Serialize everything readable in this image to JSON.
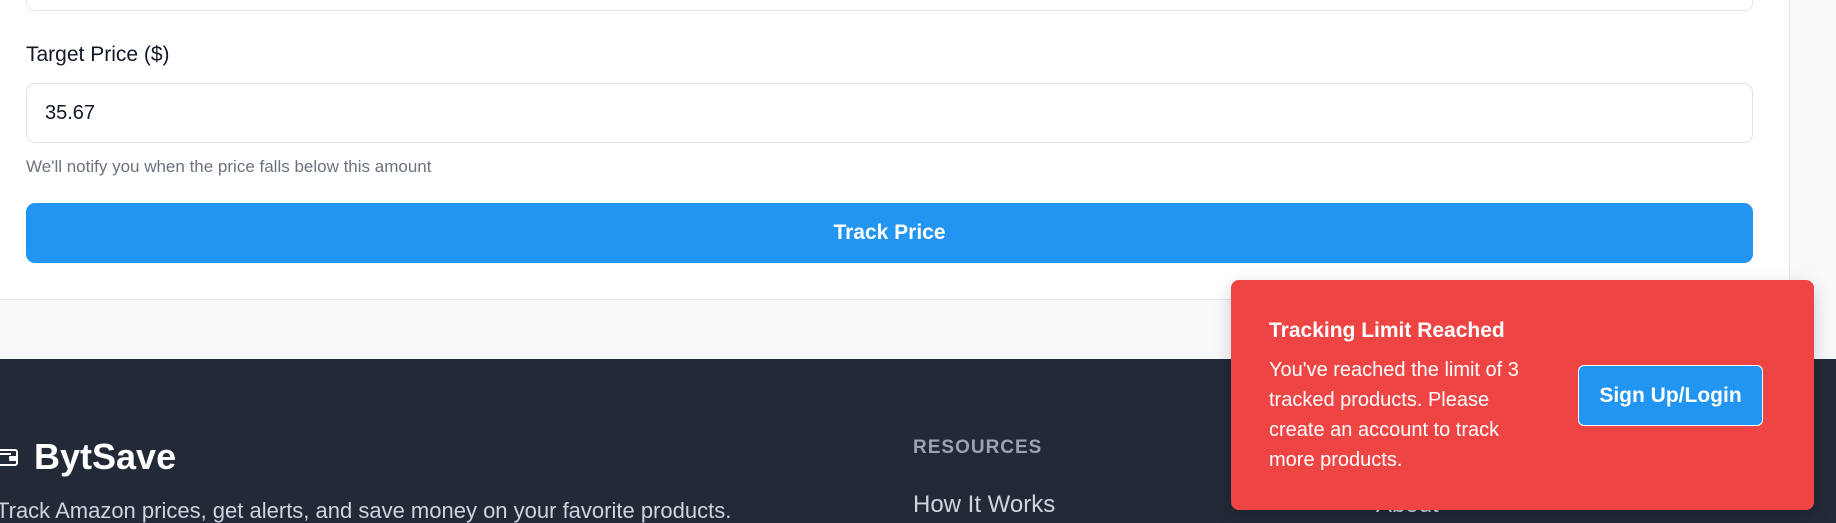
{
  "form": {
    "target_price_label": "Target Price ($)",
    "target_price_value": "35.67",
    "hint": "We'll notify you when the price falls below this amount",
    "track_button_label": "Track Price"
  },
  "footer": {
    "brand_name": "BytSave",
    "brand_icon": "wallet-icon",
    "tagline": "Track Amazon prices, get alerts, and save money on your favorite products.",
    "resources_heading": "RESOURCES",
    "resources_links": [
      "How It Works"
    ],
    "other_links": [
      "About"
    ]
  },
  "toast": {
    "title": "Tracking Limit Reached",
    "message": "You've reached the limit of 3 tracked products. Please create an account to track more products.",
    "button_label": "Sign Up/Login"
  },
  "colors": {
    "primary": "#2294f2",
    "danger": "#ef4444",
    "footer_bg": "#222a38"
  }
}
